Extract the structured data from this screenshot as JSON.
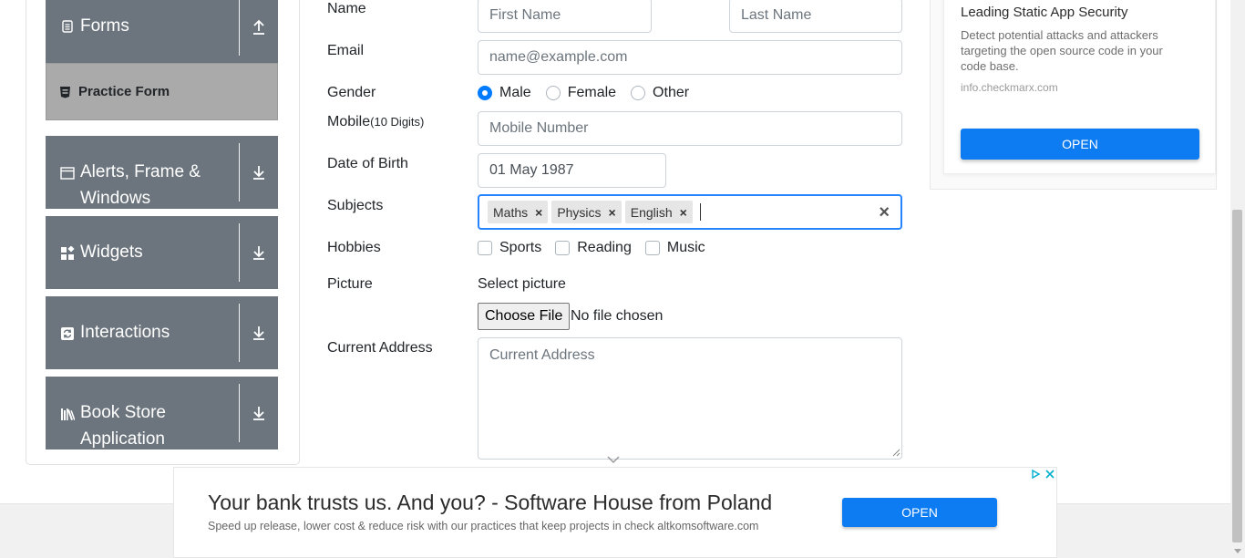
{
  "sidebar": {
    "groups": [
      {
        "label": "Forms",
        "icon": "file-icon",
        "arrow": "upload-arrow-icon"
      },
      {
        "label": "Alerts, Frame & Windows",
        "icon": "window-icon",
        "arrow": "download-arrow-icon"
      },
      {
        "label": "Widgets",
        "icon": "widgets-icon",
        "arrow": "download-arrow-icon"
      },
      {
        "label": "Interactions",
        "icon": "interactions-icon",
        "arrow": "download-arrow-icon"
      },
      {
        "label": "Book Store Application",
        "icon": "books-icon",
        "arrow": "download-arrow-icon"
      }
    ],
    "active_item": "Practice Form"
  },
  "form": {
    "name_label": "Name",
    "first_name_placeholder": "First Name",
    "last_name_placeholder": "Last Name",
    "email_label": "Email",
    "email_placeholder": "name@example.com",
    "gender_label": "Gender",
    "genders": [
      {
        "label": "Male",
        "selected": true
      },
      {
        "label": "Female",
        "selected": false
      },
      {
        "label": "Other",
        "selected": false
      }
    ],
    "mobile_label": "Mobile",
    "mobile_hint": "(10 Digits)",
    "mobile_placeholder": "Mobile Number",
    "dob_label": "Date of Birth",
    "dob_value": "01 May 1987",
    "subjects_label": "Subjects",
    "subjects": [
      "Maths",
      "Physics",
      "English"
    ],
    "hobbies_label": "Hobbies",
    "hobbies": [
      {
        "label": "Sports",
        "checked": false
      },
      {
        "label": "Reading",
        "checked": false
      },
      {
        "label": "Music",
        "checked": false
      }
    ],
    "picture_label": "Picture",
    "select_picture": "Select picture",
    "choose_file": "Choose File",
    "no_file": "No file chosen",
    "address_label": "Current Address",
    "address_placeholder": "Current Address"
  },
  "side_ad": {
    "title": "Leading Static App Security",
    "body": "Detect potential attacks and attackers targeting the open source code in your code base.",
    "domain": "info.checkmarx.com",
    "button": "OPEN"
  },
  "bottom_ad": {
    "title": "Your bank trusts us. And you? - Software House from Poland",
    "body": "Speed up release, lower cost & reduce risk with our practices that keep projects in check altkomsoftware.com",
    "button": "OPEN"
  },
  "colors": {
    "sidebar_header": "#6c757d",
    "active_item": "#aaaaaa",
    "accent": "#007bff",
    "ad_button": "#0d7cf2"
  }
}
